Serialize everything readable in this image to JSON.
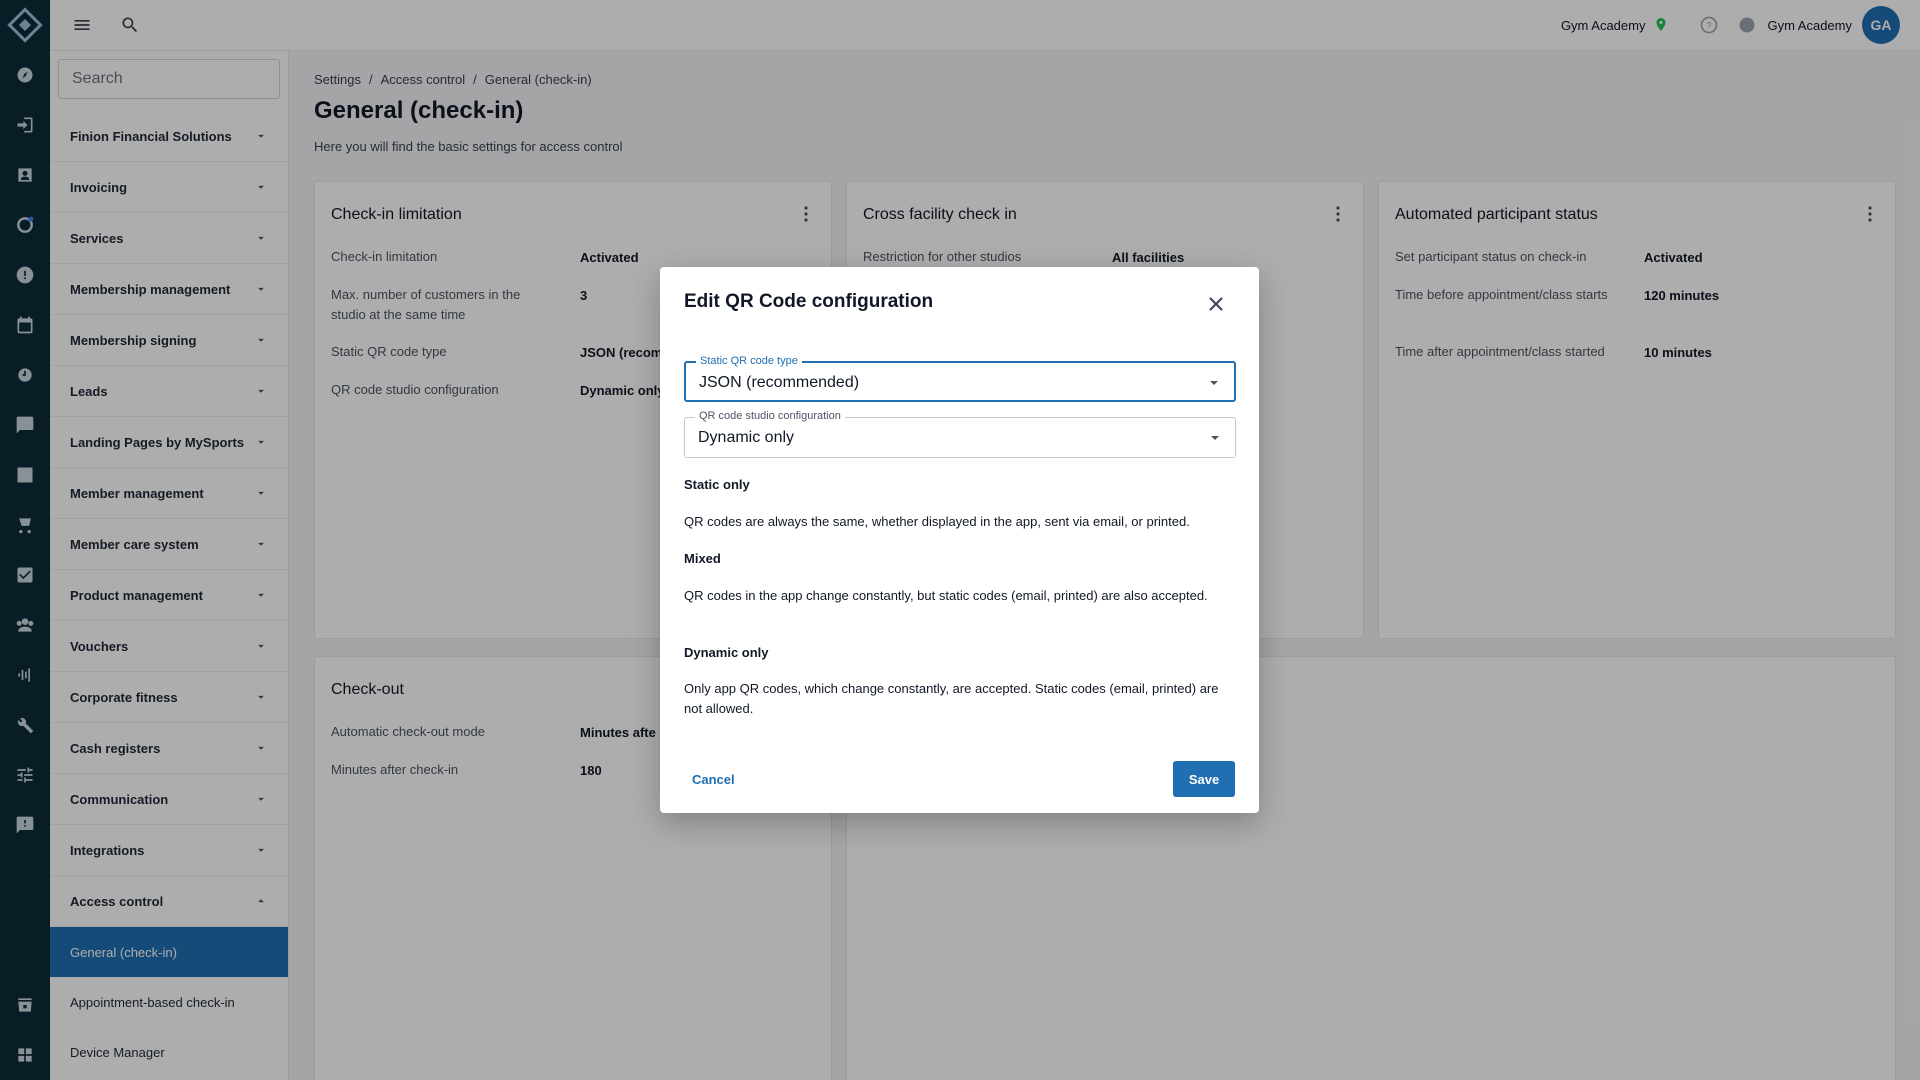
{
  "topbar": {
    "studio_name": "Gym Academy",
    "user_name": "Gym Academy",
    "avatar_initials": "GA"
  },
  "sidebar": {
    "search_placeholder": "Search",
    "items": [
      {
        "label": "Finion Financial Solutions"
      },
      {
        "label": "Invoicing"
      },
      {
        "label": "Services"
      },
      {
        "label": "Membership management"
      },
      {
        "label": "Membership signing"
      },
      {
        "label": "Leads"
      },
      {
        "label": "Landing Pages by MySports"
      },
      {
        "label": "Member management"
      },
      {
        "label": "Member care system"
      },
      {
        "label": "Product management"
      },
      {
        "label": "Vouchers"
      },
      {
        "label": "Corporate fitness"
      },
      {
        "label": "Cash registers"
      },
      {
        "label": "Communication"
      },
      {
        "label": "Integrations"
      },
      {
        "label": "Access control"
      }
    ],
    "sub_items": [
      {
        "label": "General (check-in)"
      },
      {
        "label": "Appointment-based check-in"
      },
      {
        "label": "Device Manager"
      }
    ]
  },
  "main": {
    "breadcrumb": [
      "Settings",
      "/",
      "Access control",
      "/",
      "General (check-in)"
    ],
    "title": "General (check-in)",
    "subtitle": "Here you will find the basic settings for access control",
    "cards": {
      "checkin_limitation": {
        "title": "Check-in limitation",
        "rows": [
          {
            "label": "Check-in limitation",
            "value": "Activated"
          },
          {
            "label": "Max. number of customers in the studio at the same time",
            "value": "3"
          },
          {
            "label": "Static QR code type",
            "value": "JSON (recom"
          },
          {
            "label": "QR code studio configuration",
            "value": "Dynamic only"
          }
        ]
      },
      "cross_facility": {
        "title": "Cross facility check in",
        "rows": [
          {
            "label": "Restriction for other studios",
            "value": "All facilities"
          }
        ]
      },
      "automated_status": {
        "title": "Automated participant status",
        "rows": [
          {
            "label": "Set participant status on check-in",
            "value": "Activated"
          },
          {
            "label": "Time before appointment/class starts",
            "value": "120 minutes"
          },
          {
            "label": "Time after appointment/class started",
            "value": "10 minutes"
          }
        ]
      },
      "checkout": {
        "title": "Check-out",
        "rows": [
          {
            "label": "Automatic check-out mode",
            "value": "Minutes afte"
          },
          {
            "label": "Minutes after check-in",
            "value": "180"
          }
        ]
      }
    }
  },
  "dialog": {
    "title": "Edit QR Code configuration",
    "field1": {
      "label": "Static QR code type",
      "value": "JSON (recommended)"
    },
    "field2": {
      "label": "QR code studio configuration",
      "value": "Dynamic only"
    },
    "sections": [
      {
        "heading": "Static only",
        "text": "QR codes are always the same, whether displayed in the app, sent via email, or printed."
      },
      {
        "heading": "Mixed",
        "text": "QR codes in the app change constantly, but static codes (email, printed) are also accepted."
      },
      {
        "heading": "Dynamic only",
        "text": "Only app QR codes, which change constantly, are accepted. Static codes (email, printed) are not allowed."
      }
    ],
    "cancel_label": "Cancel",
    "save_label": "Save"
  },
  "colors": {
    "rail": "#0d2c38",
    "accent": "#1f6fb2",
    "status_green": "#22c55e"
  }
}
